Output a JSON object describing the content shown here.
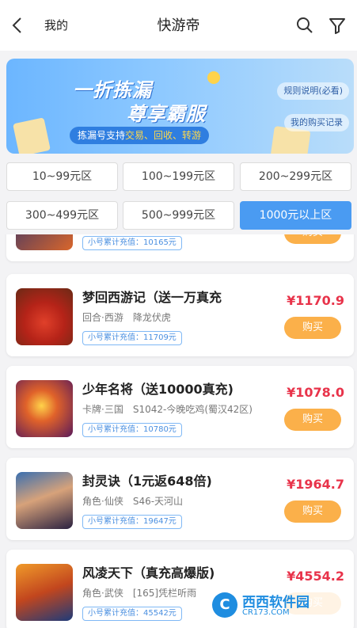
{
  "header": {
    "back_label": "我的",
    "title": "快游帝"
  },
  "banner": {
    "title_line1": "一折拣漏",
    "title_line2": "尊享霸服",
    "tagline_prefix": "拣漏号支持",
    "tagline_highlight": "交易、回收、转游",
    "rules_label": "规则说明(必看)",
    "records_label": "我的购买记录"
  },
  "ranges": [
    {
      "label": "10~99元区",
      "active": false
    },
    {
      "label": "100~199元区",
      "active": false
    },
    {
      "label": "200~299元区",
      "active": false
    },
    {
      "label": "300~499元区",
      "active": false
    },
    {
      "label": "500~999元区",
      "active": false
    },
    {
      "label": "1000元以上区",
      "active": true
    }
  ],
  "games": [
    {
      "name": "",
      "tags": [],
      "charge": "小号累计充值：10165元",
      "price": "",
      "buy_label": "购买"
    },
    {
      "name": "梦回西游记（送一万真充",
      "tags": [
        "回合·西游",
        "降龙伏虎"
      ],
      "charge": "小号累计充值：11709元",
      "price": "¥1170.9",
      "buy_label": "购买"
    },
    {
      "name": "少年名将（送10000真充)",
      "tags": [
        "卡牌·三国",
        "S1042-今晚吃鸡(蜀汉42区)"
      ],
      "charge": "小号累计充值：10780元",
      "price": "¥1078.0",
      "buy_label": "购买"
    },
    {
      "name": "封灵诀（1元返648倍)",
      "tags": [
        "角色·仙侠",
        "S46-天河山"
      ],
      "charge": "小号累计充值：19647元",
      "price": "¥1964.7",
      "buy_label": "购买"
    },
    {
      "name": "风凌天下（真充高爆版)",
      "tags": [
        "角色·武侠",
        "[165]凭栏听雨"
      ],
      "charge": "小号累计充值：45542元",
      "price": "¥4554.2",
      "buy_label": "购买"
    }
  ],
  "watermark": {
    "logo_text": "C",
    "name": "西西软件园",
    "domain": "CR173.COM"
  },
  "colors": {
    "accent": "#4a9bf2",
    "price": "#e8334a",
    "buy_button": "#fbb04a"
  }
}
